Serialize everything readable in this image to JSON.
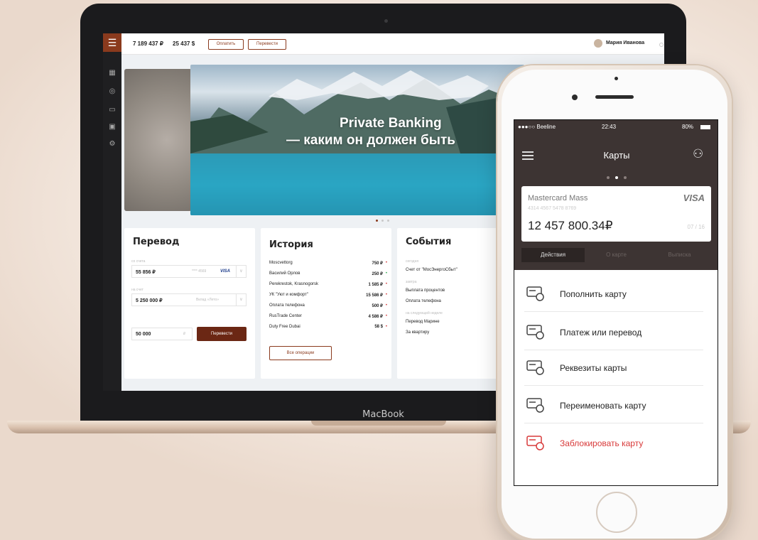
{
  "laptop": {
    "brand": "MacBook",
    "topbar": {
      "balance_rub": "7 189 437 ₽",
      "balance_usd": "25 437 $",
      "pay_button": "Оплатить",
      "transfer_button": "Перевести",
      "user_name": "Мария Иванова"
    },
    "hero": {
      "title": "Private Banking",
      "subtitle": "— каким он должен быть"
    },
    "transfer": {
      "title": "Перевод",
      "from_label": "со счета",
      "from_value": "55 856 ₽",
      "from_card_mask": "**** 4569",
      "from_card_brand": "VISA",
      "to_label": "на счет",
      "to_value": "5 250 000 ₽",
      "to_account_name": "Вклад «Лето»",
      "amount_value": "50 000",
      "amount_currency": "₽",
      "send_button": "Перевести"
    },
    "history": {
      "title": "История",
      "rows": [
        {
          "name": "Moscvettorg",
          "amount": "750 ₽",
          "sign": "minus"
        },
        {
          "name": "Василий Орлов",
          "amount": "250 ₽",
          "sign": "plus"
        },
        {
          "name": "Perekrestok, Krasnogorsk",
          "amount": "1 585 ₽",
          "sign": "minus"
        },
        {
          "name": "УК \"Уют и комфорт\"",
          "amount": "15 586 ₽",
          "sign": "minus"
        },
        {
          "name": "Оплата телефона",
          "amount": "500 ₽",
          "sign": "minus"
        },
        {
          "name": "RusTrade Center",
          "amount": "4 586 ₽",
          "sign": "minus"
        },
        {
          "name": "Duty Free Dubai",
          "amount": "58 $",
          "sign": "minus"
        }
      ],
      "all_button": "Все операции"
    },
    "events": {
      "title": "События",
      "groups": [
        {
          "label": "сегодня",
          "items": [
            {
              "name": "Счет от \"МосЭнергоСбыт\"",
              "amount": "8"
            }
          ]
        },
        {
          "label": "завтра",
          "items": [
            {
              "name": "Выплата процентов",
              "amount": "1 5"
            },
            {
              "name": "Оплата телефона",
              "amount": "5"
            }
          ]
        },
        {
          "label": "на следующей неделе",
          "items": [
            {
              "name": "Перевод Марине",
              "amount": "10 0"
            },
            {
              "name": "За квартиру",
              "amount": "30 0"
            }
          ]
        }
      ]
    }
  },
  "phone": {
    "status": {
      "carrier": "●●●○○ Beeline",
      "time": "22:43",
      "battery": "80%"
    },
    "title": "Карты",
    "card": {
      "name": "Mastercard Mass",
      "number": "4314 4567 5478 8769",
      "brand": "VISA",
      "balance": "12 457 800.34₽",
      "page": "07 / 16"
    },
    "tabs": [
      "Действия",
      "О карте",
      "Выписка"
    ],
    "actions": [
      {
        "label": "Пополнить карту",
        "icon": "card-add-icon",
        "danger": false
      },
      {
        "label": "Платеж или перевод",
        "icon": "card-transfer-icon",
        "danger": false
      },
      {
        "label": "Реквезиты карты",
        "icon": "card-info-icon",
        "danger": false
      },
      {
        "label": "Переименовать карту",
        "icon": "card-edit-icon",
        "danger": false
      },
      {
        "label": "Заблокировать карту",
        "icon": "card-block-icon",
        "danger": true
      }
    ],
    "colors": {
      "header": "#3d3433",
      "accent": "#8a3a1d",
      "danger": "#d83a3a"
    }
  }
}
